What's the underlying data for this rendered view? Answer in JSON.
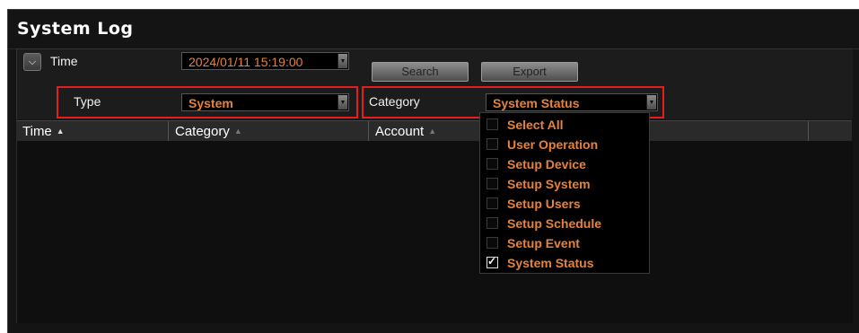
{
  "window": {
    "title": "System Log"
  },
  "filters": {
    "time_label": "Time",
    "time_value": "2024/01/11 15:19:00",
    "type_label": "Type",
    "type_value": "System",
    "category_label": "Category",
    "category_value": "System Status",
    "search_label": "Search",
    "export_label": "Export"
  },
  "table": {
    "columns": [
      {
        "label": "Time",
        "sort": "▲"
      },
      {
        "label": "Category",
        "sort": "▲"
      },
      {
        "label": "Account",
        "sort": "▲"
      }
    ]
  },
  "category_dropdown": {
    "options": [
      {
        "label": "Select All",
        "checked": false
      },
      {
        "label": "User Operation",
        "checked": false
      },
      {
        "label": "Setup Device",
        "checked": false
      },
      {
        "label": "Setup System",
        "checked": false
      },
      {
        "label": "Setup Users",
        "checked": false
      },
      {
        "label": "Setup Schedule",
        "checked": false
      },
      {
        "label": "Setup Event",
        "checked": false
      },
      {
        "label": "System Status",
        "checked": true
      }
    ]
  },
  "colors": {
    "value_text": "#e8823a",
    "highlight": "#e41e1e",
    "background": "#141414"
  }
}
